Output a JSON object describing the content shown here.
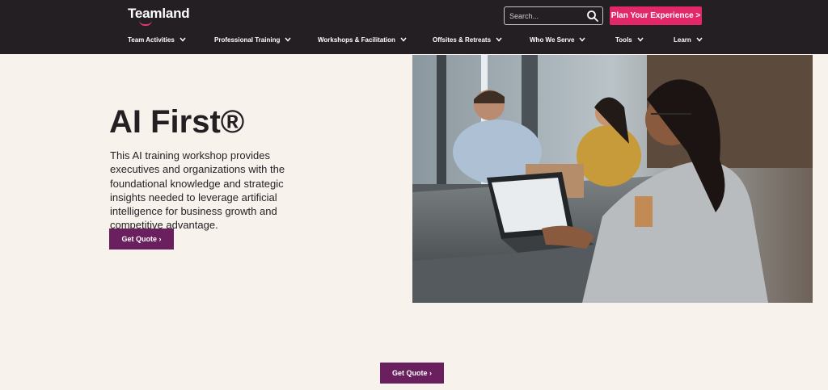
{
  "brand": {
    "logo_text": "Teamland",
    "accent_color": "#e3286a"
  },
  "header": {
    "background_color": "#231f23",
    "search": {
      "placeholder": "Search...",
      "icon": "search-icon"
    },
    "cta_label": "Plan Your Experience >"
  },
  "nav": {
    "items": [
      {
        "label": "Team Activities",
        "icon": "chevron-down-icon"
      },
      {
        "label": "Professional Training",
        "icon": "chevron-down-icon"
      },
      {
        "label": "Workshops & Facilitation",
        "icon": "chevron-down-icon"
      },
      {
        "label": "Offsites & Retreats",
        "icon": "chevron-down-icon"
      },
      {
        "label": "Who We Serve",
        "icon": "chevron-down-icon"
      },
      {
        "label": "Tools",
        "icon": "chevron-down-icon"
      },
      {
        "label": "Learn",
        "icon": "chevron-down-icon"
      }
    ]
  },
  "hero": {
    "title": "AI First®",
    "description": "This AI training workshop provides executives and organizations with the foundational knowledge and strategic insights needed to leverage artificial intelligence for business growth and competitive advantage.",
    "button_label": "Get Quote ›",
    "button_color": "#6a1f5e"
  },
  "footer_cta": {
    "button_label": "Get Quote ›"
  }
}
